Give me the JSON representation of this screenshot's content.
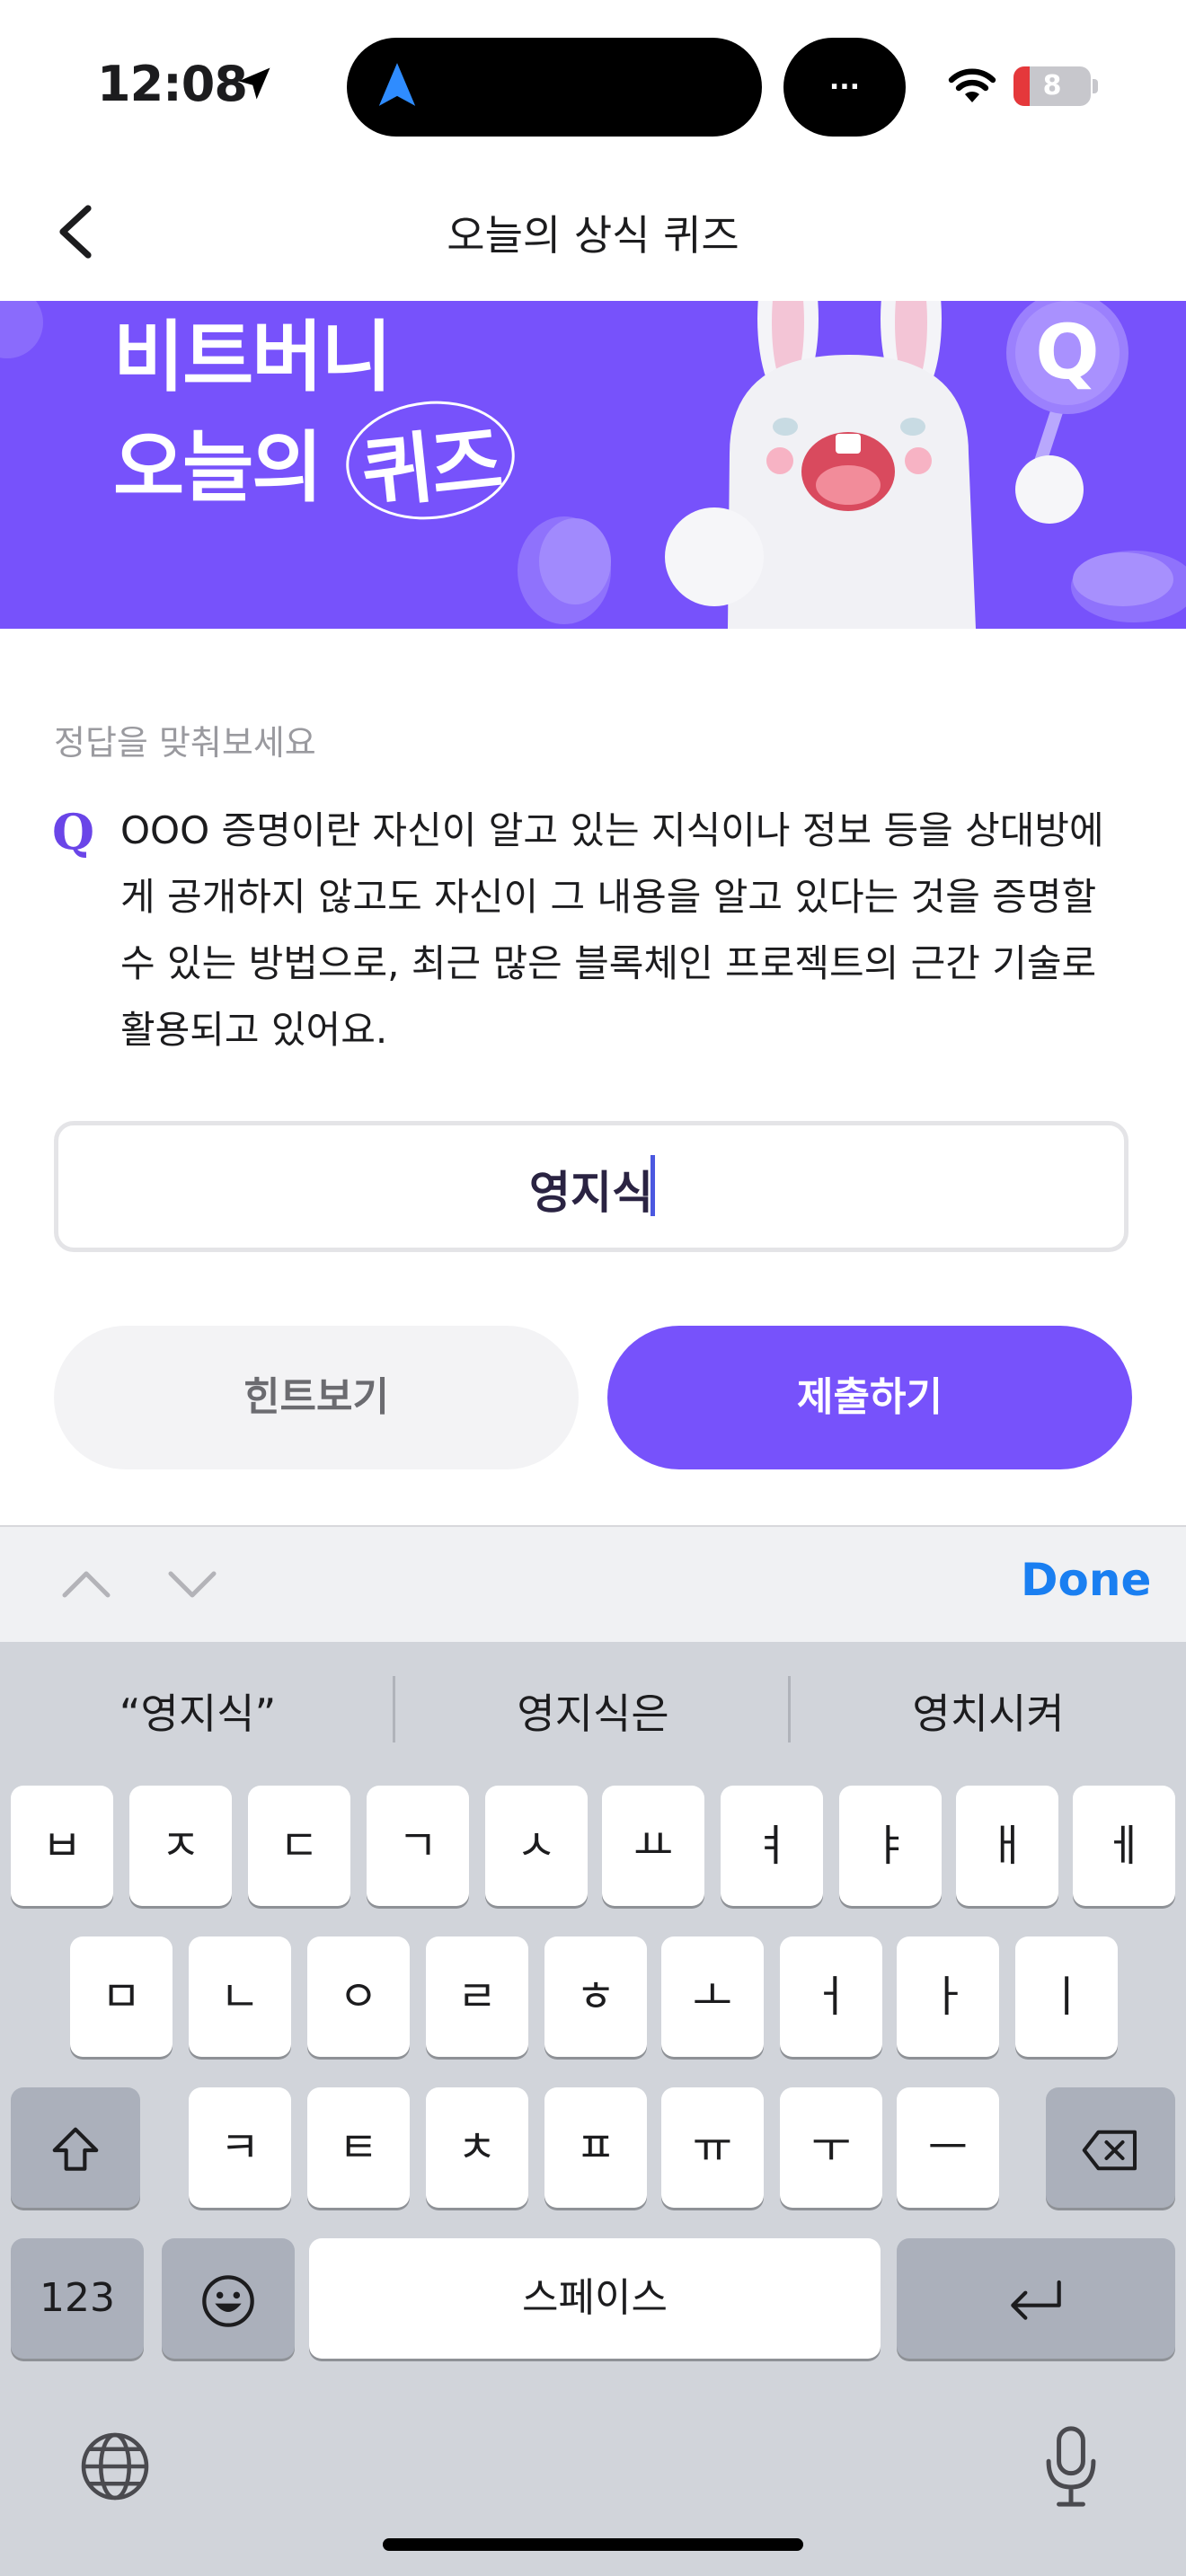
{
  "status_bar": {
    "time": "12:08",
    "island_more": "...",
    "battery_level": "8"
  },
  "nav": {
    "title": "오늘의 상식 퀴즈"
  },
  "banner": {
    "line1": "비트버니",
    "line2_prefix": "오늘의 ",
    "line2_highlight": "퀴즈",
    "badge_letter": "Q"
  },
  "quiz": {
    "instruction": "정답을 맞춰보세요",
    "q_mark": "Q",
    "question": "OOO 증명이란 자신이 알고 있는 지식이나 정보 등을 상대방에게 공개하지 않고도 자신이 그 내용을 알고 있다는 것을 증명할 수 있는 방법으로, 최근 많은 블록체인 프로젝트의 근간 기술로 활용되고 있어요.",
    "answer_value": "영지식",
    "hint_label": "힌트보기",
    "submit_label": "제출하기"
  },
  "accessory": {
    "done_label": "Done"
  },
  "keyboard": {
    "suggestions": [
      "“영지식”",
      "영지식은",
      "영치시켜"
    ],
    "row1": [
      "ㅂ",
      "ㅈ",
      "ㄷ",
      "ㄱ",
      "ㅅ",
      "ㅛ",
      "ㅕ",
      "ㅑ",
      "ㅐ",
      "ㅔ"
    ],
    "row2": [
      "ㅁ",
      "ㄴ",
      "ㅇ",
      "ㄹ",
      "ㅎ",
      "ㅗ",
      "ㅓ",
      "ㅏ",
      "ㅣ"
    ],
    "row3": [
      "ㅋ",
      "ㅌ",
      "ㅊ",
      "ㅍ",
      "ㅠ",
      "ㅜ",
      "ㅡ"
    ],
    "numbers_label": "123",
    "space_label": "스페이스"
  },
  "colors": {
    "brand_purple": "#7752fb",
    "link_blue": "#1a7ff1"
  }
}
